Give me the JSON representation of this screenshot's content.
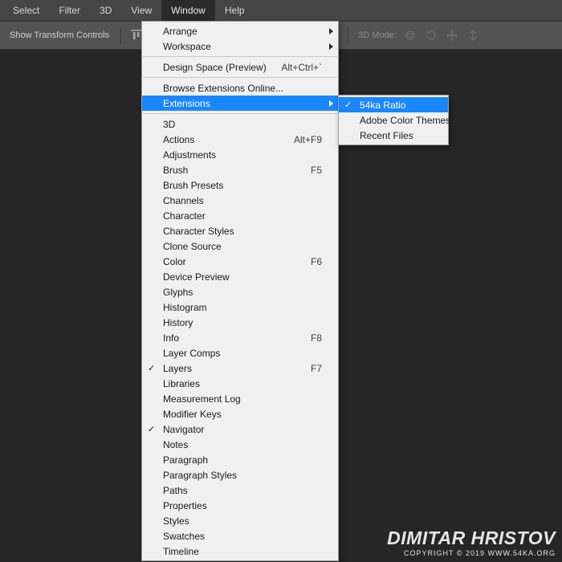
{
  "menubar": {
    "items": [
      "Select",
      "Filter",
      "3D",
      "View",
      "Window",
      "Help"
    ],
    "open_index": 4
  },
  "optionsbar": {
    "transform_label": "Show Transform Controls",
    "mode_label": "3D Mode:"
  },
  "window_menu": {
    "groups": [
      [
        {
          "label": "Arrange",
          "submenu": true
        },
        {
          "label": "Workspace",
          "submenu": true
        }
      ],
      [
        {
          "label": "Design Space (Preview)",
          "shortcut": "Alt+Ctrl+`"
        }
      ],
      [
        {
          "label": "Browse Extensions Online..."
        },
        {
          "label": "Extensions",
          "submenu": true,
          "highlight": true
        }
      ],
      [
        {
          "label": "3D"
        },
        {
          "label": "Actions",
          "shortcut": "Alt+F9"
        },
        {
          "label": "Adjustments"
        },
        {
          "label": "Brush",
          "shortcut": "F5"
        },
        {
          "label": "Brush Presets"
        },
        {
          "label": "Channels"
        },
        {
          "label": "Character"
        },
        {
          "label": "Character Styles"
        },
        {
          "label": "Clone Source"
        },
        {
          "label": "Color",
          "shortcut": "F6"
        },
        {
          "label": "Device Preview"
        },
        {
          "label": "Glyphs"
        },
        {
          "label": "Histogram"
        },
        {
          "label": "History"
        },
        {
          "label": "Info",
          "shortcut": "F8"
        },
        {
          "label": "Layer Comps"
        },
        {
          "label": "Layers",
          "shortcut": "F7",
          "checked": true
        },
        {
          "label": "Libraries"
        },
        {
          "label": "Measurement Log"
        },
        {
          "label": "Modifier Keys"
        },
        {
          "label": "Navigator",
          "checked": true
        },
        {
          "label": "Notes"
        },
        {
          "label": "Paragraph"
        },
        {
          "label": "Paragraph Styles"
        },
        {
          "label": "Paths"
        },
        {
          "label": "Properties"
        },
        {
          "label": "Styles"
        },
        {
          "label": "Swatches"
        },
        {
          "label": "Timeline"
        }
      ]
    ]
  },
  "extensions_submenu": {
    "items": [
      {
        "label": "54ka Ratio",
        "checked": true,
        "highlight": true
      },
      {
        "label": "Adobe Color Themes"
      },
      {
        "label": "Recent Files"
      }
    ]
  },
  "watermark": {
    "name": "DIMITAR HRISTOV",
    "copy": "COPYRIGHT © 2019 WWW.54KA.ORG"
  }
}
